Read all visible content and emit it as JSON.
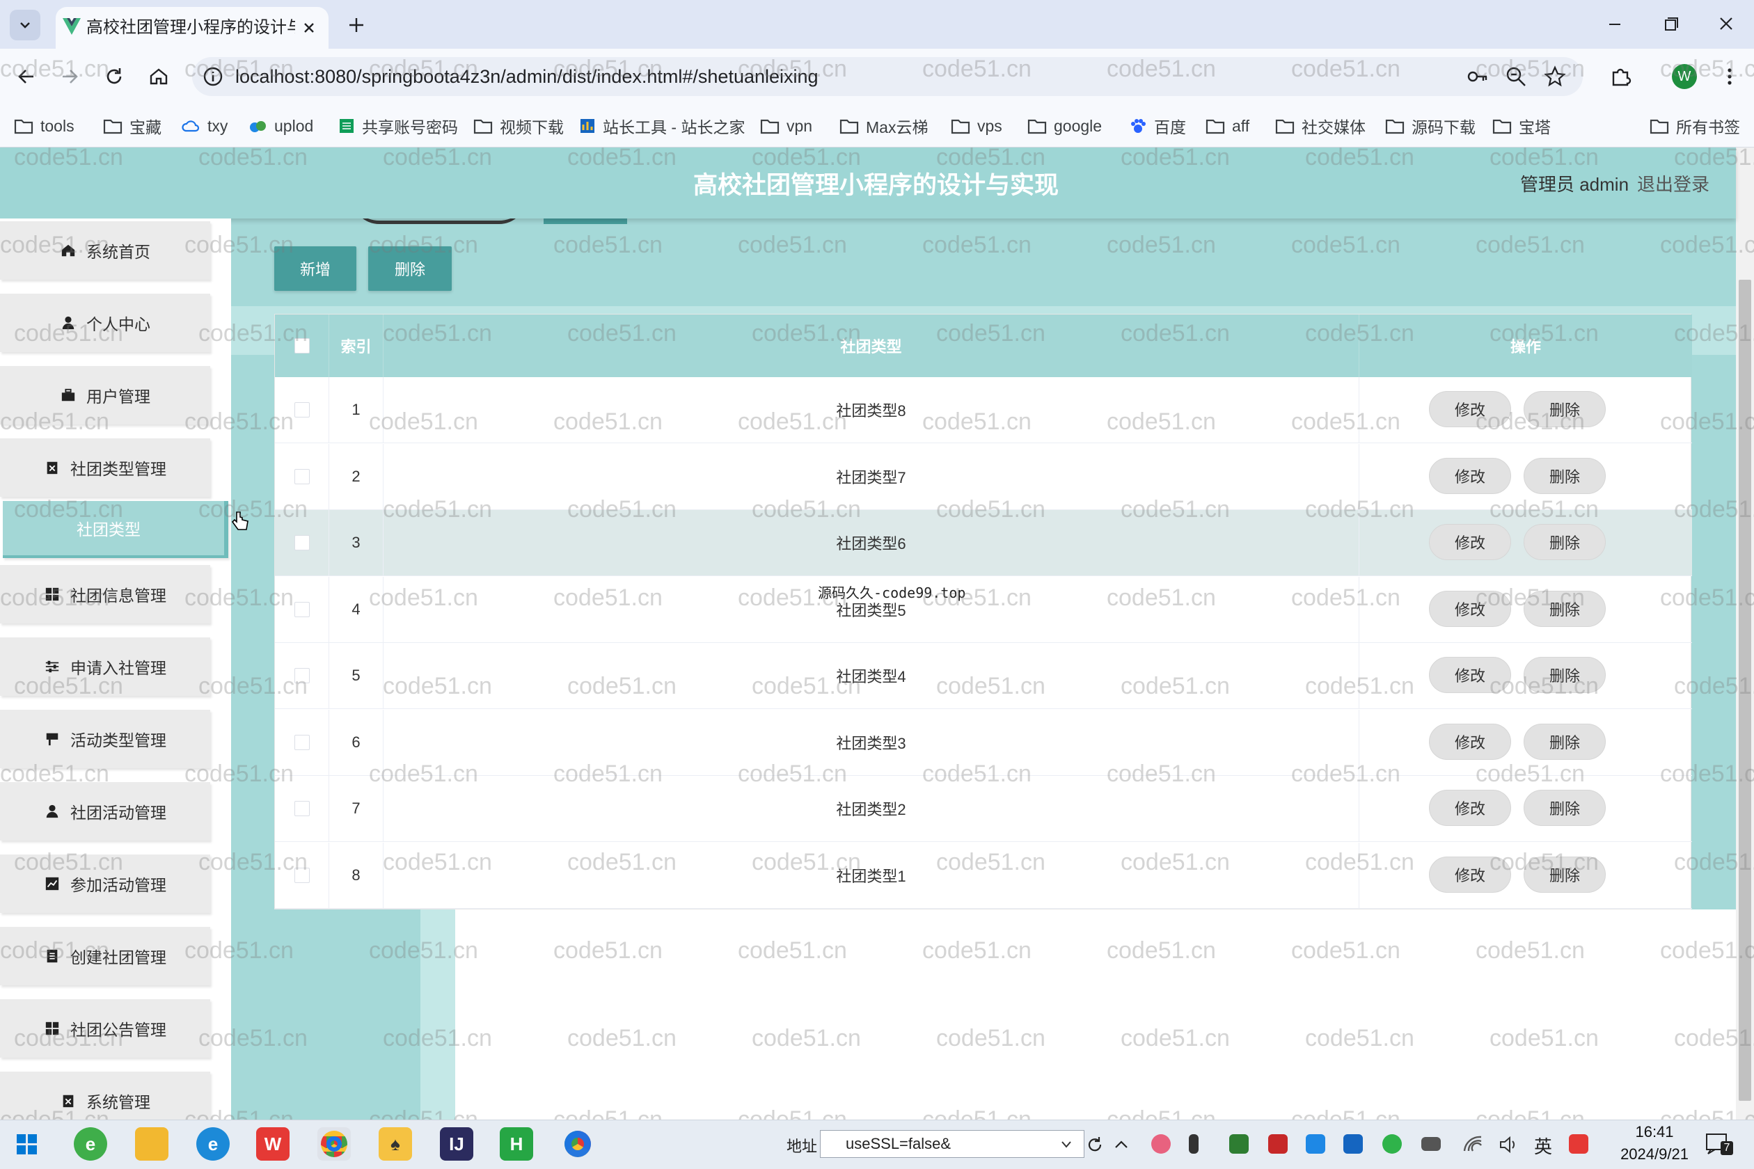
{
  "browser": {
    "tab_title": "高校社团管理小程序的设计与实",
    "url": "localhost:8080/springboota4z3n/admin/dist/index.html#/shetuanleixing",
    "profile_initial": "W",
    "bookmarks": [
      "tools",
      "宝藏",
      "txy",
      "uplod",
      "共享账号密码",
      "视频下载",
      "站长工具 - 站长之家",
      "vpn",
      "Max云梯",
      "vps",
      "google",
      "百度",
      "aff",
      "社交媒体",
      "源码下载",
      "宝塔"
    ],
    "all_bookmarks": "所有书签"
  },
  "header": {
    "title": "高校社团管理小程序的设计与实现",
    "user": "管理员 admin",
    "logout": "退出登录"
  },
  "sidebar": {
    "items": [
      {
        "label": "系统首页",
        "icon": "home-icon"
      },
      {
        "label": "个人中心",
        "icon": "person-icon"
      },
      {
        "label": "用户管理",
        "icon": "briefcase-icon"
      },
      {
        "label": "社团类型管理",
        "icon": "clipboard-icon"
      },
      {
        "label": "社团类型",
        "icon": ""
      },
      {
        "label": "社团信息管理",
        "icon": "grid-icon"
      },
      {
        "label": "申请入社管理",
        "icon": "sliders-icon"
      },
      {
        "label": "活动类型管理",
        "icon": "flag-icon"
      },
      {
        "label": "社团活动管理",
        "icon": "person-icon"
      },
      {
        "label": "参加活动管理",
        "icon": "chart-icon"
      },
      {
        "label": "创建社团管理",
        "icon": "document-icon"
      },
      {
        "label": "社团公告管理",
        "icon": "grid-icon"
      },
      {
        "label": "系统管理",
        "icon": "clipboard-icon"
      }
    ]
  },
  "toolbar": {
    "add_label": "新增",
    "delete_label": "删除"
  },
  "table": {
    "headers": {
      "index": "索引",
      "type": "社团类型",
      "actions": "操作"
    },
    "rows": [
      {
        "index": "1",
        "type": "社团类型8"
      },
      {
        "index": "2",
        "type": "社团类型7"
      },
      {
        "index": "3",
        "type": "社团类型6"
      },
      {
        "index": "4",
        "type": "社团类型5"
      },
      {
        "index": "5",
        "type": "社团类型4"
      },
      {
        "index": "6",
        "type": "社团类型3"
      },
      {
        "index": "7",
        "type": "社团类型2"
      },
      {
        "index": "8",
        "type": "社团类型1"
      }
    ],
    "edit_label": "修改",
    "delete_label": "删除",
    "overlay_note": "源码久久-code99.top"
  },
  "watermark": "code51.cn",
  "taskbar": {
    "address_label": "地址",
    "address_value": "useSSL=false&",
    "ime": "英",
    "time": "16:41",
    "date": "2024/9/21",
    "notification_count": "7"
  },
  "colors": {
    "accent": "#479d9c",
    "header": "#9ed6d5",
    "page_bg": "#a5d9d8",
    "active_menu": "#a3d7d6"
  }
}
